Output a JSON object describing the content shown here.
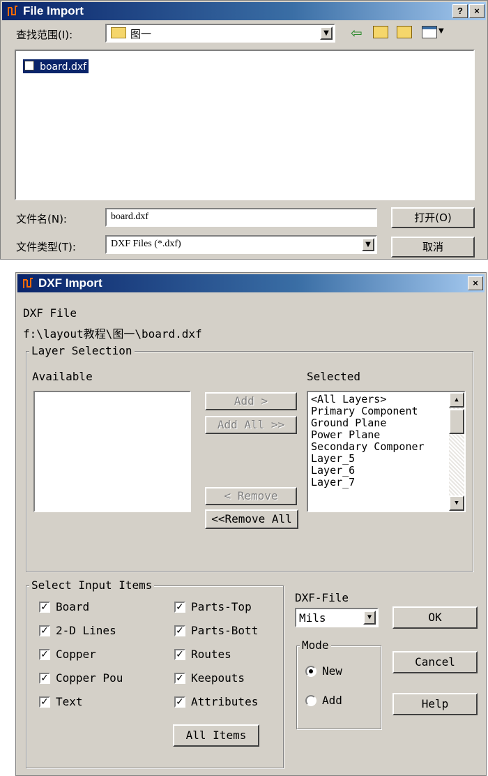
{
  "file_import": {
    "title": "File Import",
    "look_in_label": "查找范围(I):",
    "look_in_value": "图一",
    "files": [
      "board.dxf"
    ],
    "filename_label": "文件名(N):",
    "filename_value": "board.dxf",
    "filetype_label": "文件类型(T):",
    "filetype_value": "DXF Files (*.dxf)",
    "open_label": "打开(O)",
    "cancel_label": "取消",
    "help_glyph": "?",
    "close_glyph": "×"
  },
  "dxf_import": {
    "title": "DXF Import",
    "close_glyph": "×",
    "dxf_file_label": "DXF File",
    "dxf_file_path": "f:\\layout教程\\图一\\board.dxf",
    "layer_selection_title": "Layer Selection",
    "available_label": "Available",
    "selected_label": "Selected",
    "add_label": "Add >",
    "add_all_label": "Add All >>",
    "remove_label": "< Remove",
    "remove_all_label": "<<Remove All",
    "selected_layers": [
      "<All Layers>",
      "Primary Component",
      "Ground Plane",
      "Power Plane",
      "Secondary Componer",
      "Layer_5",
      "Layer_6",
      "Layer_7"
    ],
    "select_items_title": "Select Input Items",
    "items_left": [
      {
        "label": "Board",
        "checked": true
      },
      {
        "label": "2-D Lines",
        "checked": true
      },
      {
        "label": "Copper",
        "checked": true
      },
      {
        "label": "Copper Pou",
        "checked": true
      },
      {
        "label": "Text",
        "checked": true
      }
    ],
    "items_right": [
      {
        "label": "Parts-Top",
        "checked": true
      },
      {
        "label": "Parts-Bott",
        "checked": true
      },
      {
        "label": "Routes",
        "checked": true
      },
      {
        "label": "Keepouts",
        "checked": true
      },
      {
        "label": "Attributes",
        "checked": true
      }
    ],
    "all_items_label": "All Items",
    "dxf_file_units_label": "DXF-File",
    "units_value": "Mils",
    "mode_title": "Mode",
    "mode_new": "New",
    "mode_add": "Add",
    "mode_selected": "New",
    "ok_label": "OK",
    "cancel_label": "Cancel",
    "help_label": "Help"
  },
  "colors": {
    "title_start": "#0a246a",
    "title_end": "#a6caf0",
    "face": "#d4d0c8"
  }
}
